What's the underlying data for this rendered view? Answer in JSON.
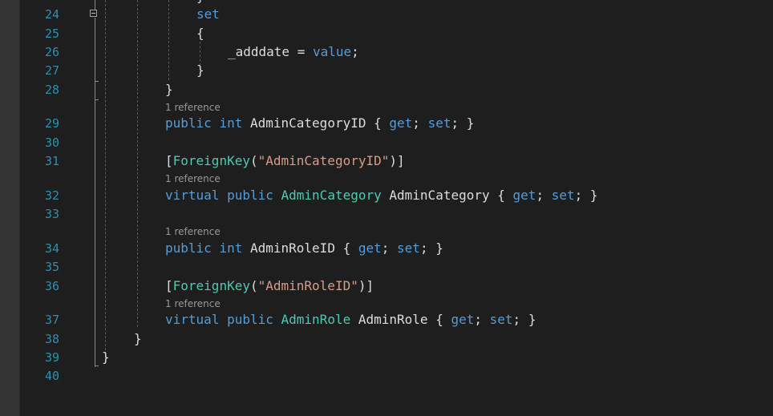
{
  "line_numbers": [
    "24",
    "25",
    "26",
    "27",
    "28",
    "29",
    "30",
    "31",
    "32",
    "33",
    "34",
    "35",
    "36",
    "37",
    "38",
    "39",
    "40"
  ],
  "code": {
    "l24": {
      "set_kw": "set"
    },
    "l25": {
      "brace": "{"
    },
    "l26": {
      "field": "_adddate",
      "op": " = ",
      "value_kw": "value",
      "semi": ";"
    },
    "l27": {
      "brace": "}"
    },
    "l28": {
      "brace": "}"
    },
    "lens29": "1 reference",
    "l29": {
      "public": "public",
      "int": "int",
      "name": "AdminCategoryID",
      "open": " { ",
      "get": "get",
      "semi1": "; ",
      "set": "set",
      "close": "; }"
    },
    "l31": {
      "open": "[",
      "attr": "ForeignKey",
      "paren": "(",
      "str": "\"AdminCategoryID\"",
      "close": ")]"
    },
    "lens32": "1 reference",
    "l32": {
      "virtual": "virtual",
      "public": "public",
      "type": "AdminCategory",
      "name": "AdminCategory",
      "open": " { ",
      "get": "get",
      "semi1": "; ",
      "set": "set",
      "close": "; }"
    },
    "lens34": "1 reference",
    "l34": {
      "public": "public",
      "int": "int",
      "name": "AdminRoleID",
      "open": " { ",
      "get": "get",
      "semi1": "; ",
      "set": "set",
      "close": "; }"
    },
    "l36": {
      "open": "[",
      "attr": "ForeignKey",
      "paren": "(",
      "str": "\"AdminRoleID\"",
      "close": ")]"
    },
    "lens37": "1 reference",
    "l37": {
      "virtual": "virtual",
      "public": "public",
      "type": "AdminRole",
      "name": "AdminRole",
      "open": " { ",
      "get": "get",
      "semi1": "; ",
      "set": "set",
      "close": "; }"
    },
    "l38": {
      "brace": "}"
    },
    "l39": {
      "brace": "}"
    }
  },
  "colors": {
    "background": "#1e1e1e",
    "line_number": "#2b91af",
    "keyword": "#569cd6",
    "type": "#4ec9b0",
    "string": "#d69d85",
    "text": "#dcdcdc",
    "codelens": "#999999"
  }
}
